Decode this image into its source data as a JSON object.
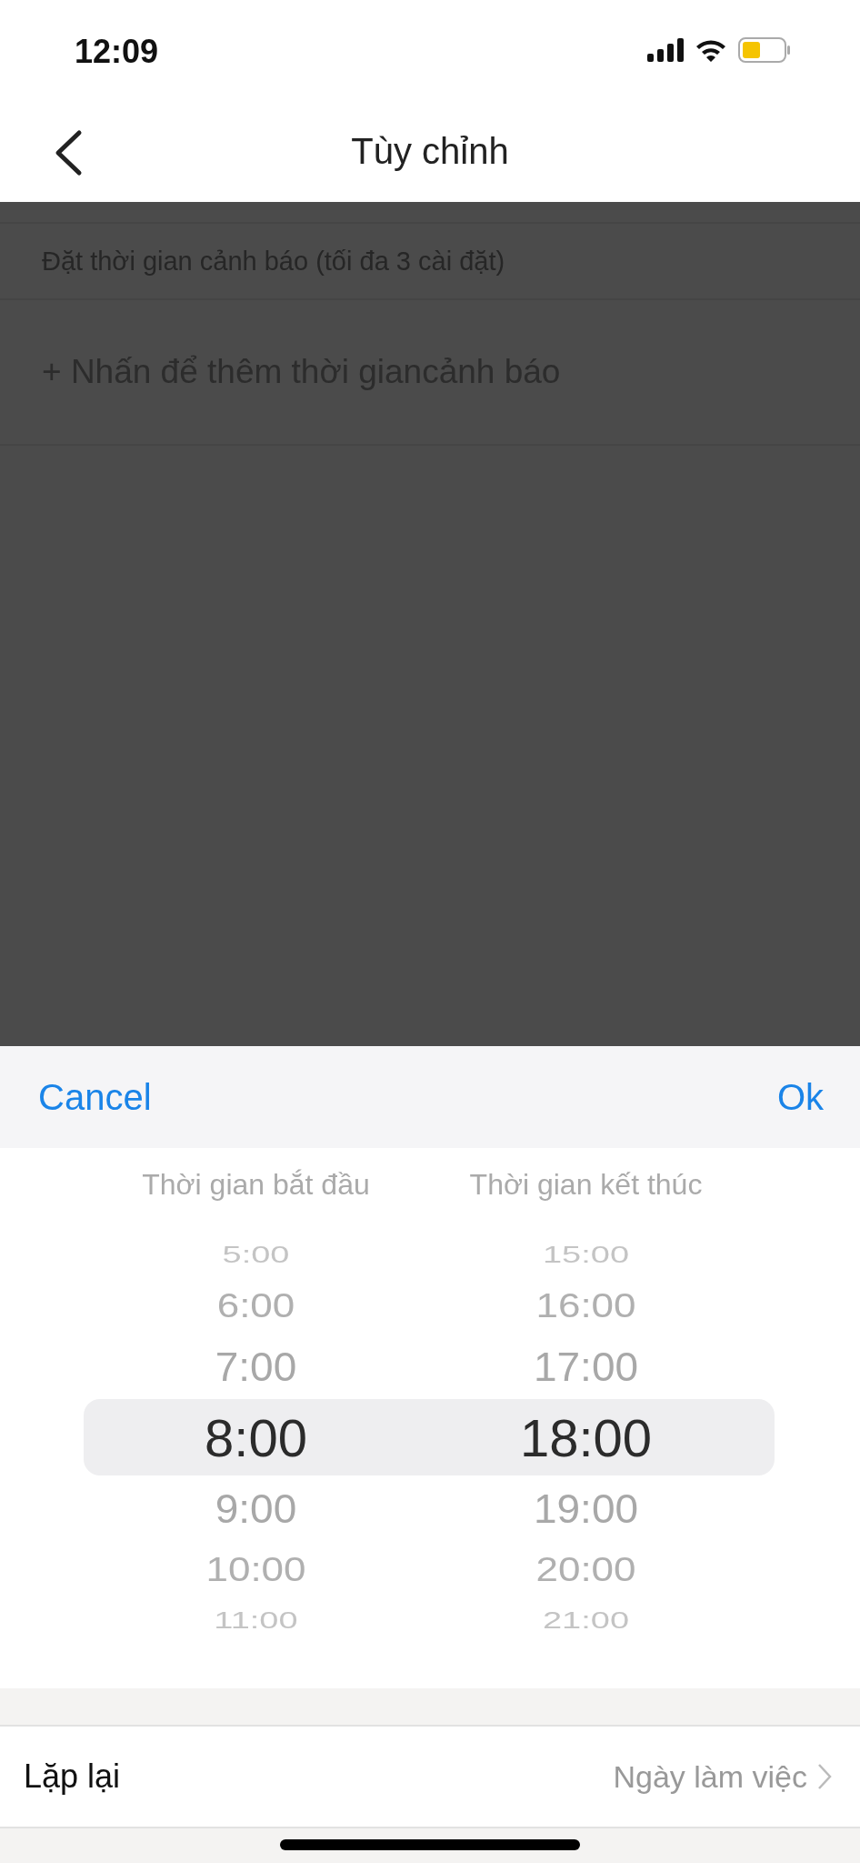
{
  "status_bar": {
    "time": "12:09"
  },
  "nav": {
    "title": "Tùy chỉnh"
  },
  "alert_section": {
    "caption": "Đặt thời gian cảnh báo (tối đa 3 cài đặt)",
    "add_label": "+ Nhấn để thêm thời giancảnh báo"
  },
  "sheet": {
    "cancel": "Cancel",
    "ok": "Ok",
    "columns": [
      {
        "label": "Thời gian bắt đầu",
        "options": [
          {
            "text": "5:00",
            "selected": false
          },
          {
            "text": "6:00",
            "selected": false
          },
          {
            "text": "7:00",
            "selected": false
          },
          {
            "text": "8:00",
            "selected": true
          },
          {
            "text": "9:00",
            "selected": false
          },
          {
            "text": "10:00",
            "selected": false
          },
          {
            "text": "11:00",
            "selected": false
          }
        ]
      },
      {
        "label": "Thời gian kết thúc",
        "options": [
          {
            "text": "15:00",
            "selected": false
          },
          {
            "text": "16:00",
            "selected": false
          },
          {
            "text": "17:00",
            "selected": false
          },
          {
            "text": "18:00",
            "selected": true
          },
          {
            "text": "19:00",
            "selected": false
          },
          {
            "text": "20:00",
            "selected": false
          },
          {
            "text": "21:00",
            "selected": false
          }
        ]
      }
    ]
  },
  "repeat_row": {
    "label": "Lặp lại",
    "value": "Ngày làm việc"
  }
}
